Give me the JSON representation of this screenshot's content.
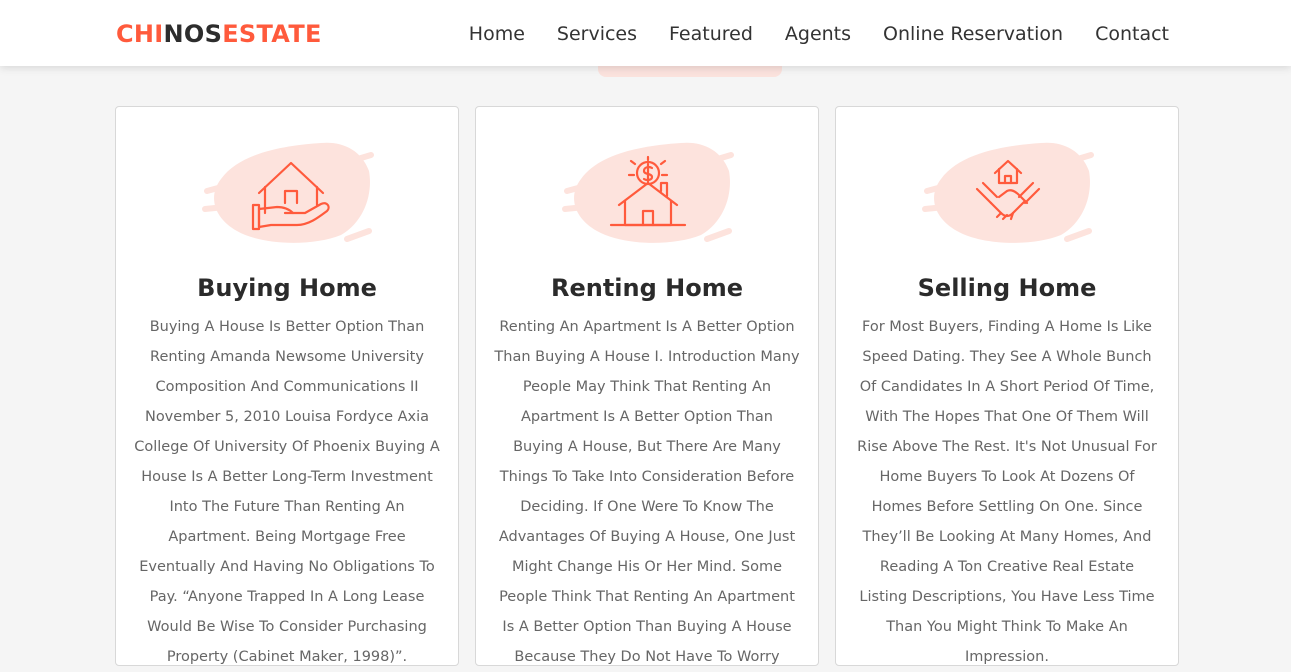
{
  "brand": {
    "part1": "CHI",
    "part2": "NOS",
    "part3": "ESTATE",
    "accent_color": "#ff5a3c"
  },
  "nav": {
    "items": [
      "Home",
      "Services",
      "Featured",
      "Agents",
      "Online Reservation",
      "Contact"
    ]
  },
  "services": [
    {
      "icon": "house-in-hand-icon",
      "title": "Buying Home",
      "text": "Buying A House Is Better Option Than Renting Amanda Newsome University Composition And Communications II November 5, 2010 Louisa Fordyce Axia College Of University Of Phoenix Buying A House Is A Better Long-Term Investment Into The Future Than Renting An Apartment. Being Mortgage Free Eventually And Having No Obligations To Pay. “Anyone Trapped In A Long Lease Would Be Wise To Consider Purchasing Property (Cabinet Maker, 1998)”."
    },
    {
      "icon": "house-with-dollar-icon",
      "title": "Renting Home",
      "text": "Renting An Apartment Is A Better Option Than Buying A House I. Introduction Many People May Think That Renting An Apartment Is A Better Option Than Buying A House, But There Are Many Things To Take Into Consideration Before Deciding. If One Were To Know The Advantages Of Buying A House, One Just Might Change His Or Her Mind. Some People Think That Renting An Apartment Is A Better Option Than Buying A House Because They Do Not Have To Worry"
    },
    {
      "icon": "handshake-house-icon",
      "title": "Selling Home",
      "text": "For Most Buyers, Finding A Home Is Like Speed Dating. They See A Whole Bunch Of Candidates In A Short Period Of Time, With The Hopes That One Of Them Will Rise Above The Rest. It's Not Unusual For Home Buyers To Look At Dozens Of Homes Before Settling On One. Since They’ll Be Looking At Many Homes, And Reading A Ton Creative Real Estate Listing Descriptions, You Have Less Time Than You Might Think To Make An Impression."
    }
  ]
}
